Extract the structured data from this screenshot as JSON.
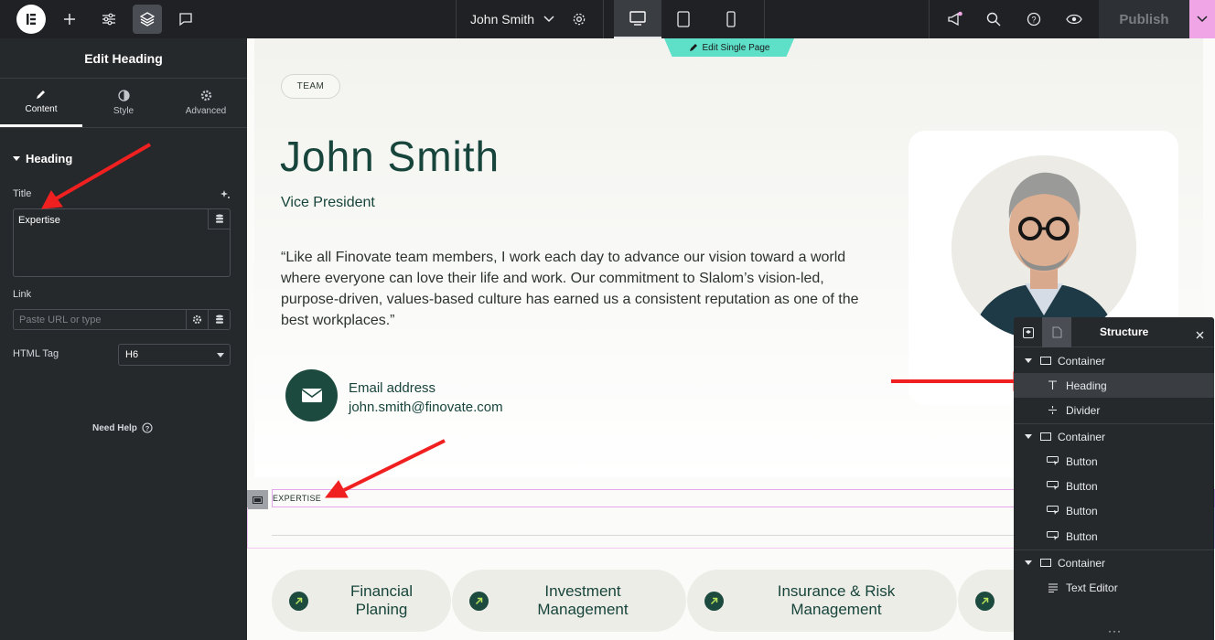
{
  "topbar": {
    "page_name": "John Smith",
    "publish": "Publish"
  },
  "panel": {
    "title": "Edit Heading",
    "tabs": [
      {
        "label": "Content",
        "icon": "pencil-icon",
        "active": true
      },
      {
        "label": "Style",
        "icon": "half-circle-icon",
        "active": false
      },
      {
        "label": "Advanced",
        "icon": "gear-icon",
        "active": false
      }
    ],
    "section": "Heading",
    "title_label": "Title",
    "title_value": "Expertise",
    "link_label": "Link",
    "link_placeholder": "Paste URL or type",
    "html_tag_label": "HTML Tag",
    "html_tag_value": "H6",
    "need_help": "Need Help"
  },
  "canvas": {
    "edit_tag": "Edit Single Page",
    "team_badge": "TEAM",
    "name": "John Smith",
    "role": "Vice President",
    "quote": "“Like all Finovate team members, I work each day to advance our vision toward a world where everyone can love their life and work. Our commitment to Slalom’s vision-led, purpose-driven, values-based culture has earned us a consistent reputation as one of the best workplaces.”",
    "email_label": "Email address",
    "email_value": "john.smith@finovate.com",
    "expertise": "EXPERTISE",
    "services": [
      {
        "line1": "Financial",
        "line2": "Planing"
      },
      {
        "line1": "Investment",
        "line2": "Management"
      },
      {
        "line1": "Insurance & Risk",
        "line2": "Management"
      },
      {
        "line1": "",
        "line2": ""
      }
    ]
  },
  "structure": {
    "title": "Structure",
    "items": [
      {
        "label": "Container",
        "level": 0,
        "icon": "container-icon"
      },
      {
        "label": "Heading",
        "level": 1,
        "icon": "heading-icon",
        "selected": true
      },
      {
        "label": "Divider",
        "level": 1,
        "icon": "divider-icon"
      },
      {
        "label": "Container",
        "level": 0,
        "icon": "container-icon"
      },
      {
        "label": "Button",
        "level": 1,
        "icon": "button-icon"
      },
      {
        "label": "Button",
        "level": 1,
        "icon": "button-icon"
      },
      {
        "label": "Button",
        "level": 1,
        "icon": "button-icon"
      },
      {
        "label": "Button",
        "level": 1,
        "icon": "button-icon"
      },
      {
        "label": "Container",
        "level": 0,
        "icon": "container-icon"
      },
      {
        "label": "Text Editor",
        "level": 1,
        "icon": "text-editor-icon"
      }
    ]
  },
  "colors": {
    "accent_green": "#17453b",
    "edit_tag": "#5ddfc8",
    "annotation_red": "#f02020",
    "selection_pink": "#e6a6ec"
  }
}
